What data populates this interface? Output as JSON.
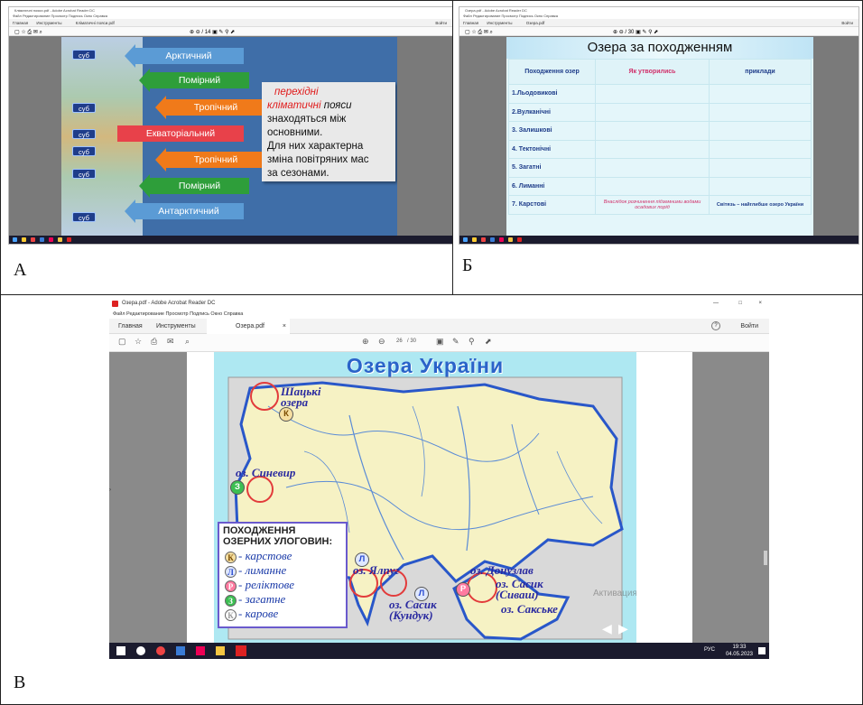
{
  "panels": {
    "a": {
      "letter": "А",
      "window": {
        "title": "Кліматичні пояси.pdf - Adobe Acrobat Reader DC",
        "menu": "Файл  Редактирование  Просмотр  Подпись  Окно  Справка",
        "tabs": [
          "Главная",
          "Инструменты",
          "Кліматичні пояси.pdf"
        ],
        "sign_in": "Войти",
        "page_counter": "/ 14"
      },
      "slide": {
        "suf_label": "суб",
        "bands": [
          "Арктичний",
          "Помірний",
          "Тропічний",
          "Екваторіальний",
          "Тропічний",
          "Помірний",
          "Антарктичний"
        ],
        "note": {
          "line1": "перехідні",
          "line2_red": "кліматичні",
          "line2_rest": " пояси",
          "line3": "знаходяться між",
          "line4": "основними.",
          "line5": "Для них характерна",
          "line6": "зміна повітряних мас",
          "line7": "за сезонами."
        }
      }
    },
    "b": {
      "letter": "Б",
      "window": {
        "title": "Озера.pdf - Adobe Acrobat Reader DC",
        "menu": "Файл  Редактирование  Просмотр  Подпись  Окно  Справка",
        "tabs": [
          "Главная",
          "Инструменты",
          "Озера.pdf"
        ],
        "sign_in": "Войти",
        "page_counter": "/ 30"
      },
      "slide": {
        "title": "Озера за походженням",
        "headers": [
          "Походження озер",
          "Як утворились",
          "приклади"
        ],
        "rows": [
          {
            "origin": "1.Льодовикові",
            "how": "",
            "example": ""
          },
          {
            "origin": "2.Вулканічні",
            "how": "",
            "example": ""
          },
          {
            "origin": "3. Залишкові",
            "how": "",
            "example": ""
          },
          {
            "origin": "4. Тектонічні",
            "how": "",
            "example": ""
          },
          {
            "origin": "5. Загатні",
            "how": "",
            "example": ""
          },
          {
            "origin": "6. Лиманні",
            "how": "",
            "example": ""
          },
          {
            "origin": "7. Карстові",
            "how": "Внаслідок розчинення підземними водами осадових порід",
            "example": "Світязь – найглибше озеро України"
          }
        ]
      }
    },
    "c": {
      "letter": "В",
      "window": {
        "title": "Озера.pdf - Adobe Acrobat Reader DC",
        "menu": "Файл   Редактирование   Просмотр   Подпись   Окно   Справка",
        "tabs": [
          "Главная",
          "Инструменты",
          "Озера.pdf"
        ],
        "close_tab": "×",
        "sign_in": "Войти",
        "page_current": "26",
        "page_total": "/ 30",
        "help_icon": "?",
        "win_controls": [
          "—",
          "□",
          "×"
        ]
      },
      "map": {
        "title": "Озера України",
        "labels": {
          "shatsk": "Шацькі\nозера",
          "synevyr": "оз. Синевир",
          "yalpug": "оз. Ялпуг",
          "sasyk_kunduk": "оз. Сасик\n(Кундук)",
          "donuzlav": "оз. Донузлав",
          "sasyk_syvash": "оз. Сасик\n(Сиваш)",
          "saki": "оз. Сакське"
        },
        "badges": {
          "K": "К",
          "Z": "З",
          "L": "Л",
          "R": "Р"
        },
        "legend": {
          "title": "ПОХОДЖЕННЯ ОЗЕРНИХ УЛОГОВИН:",
          "items": [
            {
              "mark": "К",
              "text": "- карстове"
            },
            {
              "mark": "Л",
              "text": "- лиманне"
            },
            {
              "mark": "Р",
              "text": "- реліктове"
            },
            {
              "mark": "З",
              "text": "- загатне"
            },
            {
              "mark": "К",
              "text": "- карове"
            }
          ]
        },
        "watermark": "Активация Windows"
      },
      "taskbar": {
        "time": "19:33",
        "date": "04.05.2023",
        "lang": "РУС"
      }
    }
  },
  "colors": {
    "band_arctic": "#5b9bd5",
    "band_temperate": "#2e9e3a",
    "band_tropical": "#f07a1a",
    "band_equatorial": "#e8414a",
    "sea": "#aee8f2",
    "land": "#f6f2c4",
    "border": "#2957c9"
  }
}
